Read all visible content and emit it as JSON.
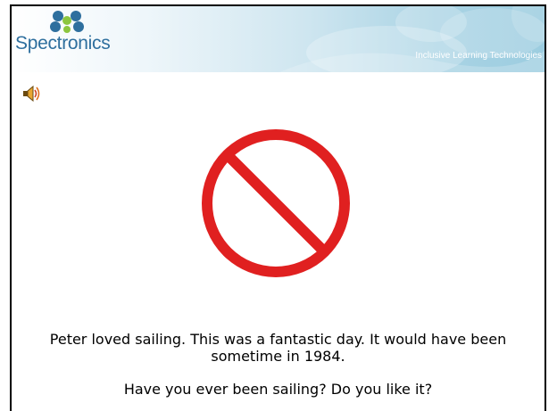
{
  "header": {
    "logo_text": "Spectronics",
    "tagline": "Inclusive Learning Technologies"
  },
  "audio": {
    "icon": "speaker-icon"
  },
  "image": {
    "icon": "prohibition-sign-icon",
    "color": "#e02020"
  },
  "captions": [
    "Peter loved sailing. This was a fantastic day.  It would have been sometime in 1984.",
    "Have you ever been sailing?  Do you like it?"
  ],
  "colors": {
    "brand_blue": "#2e6f9e",
    "header_accent": "#9ccde0",
    "flower_green": "#8cc63f"
  }
}
